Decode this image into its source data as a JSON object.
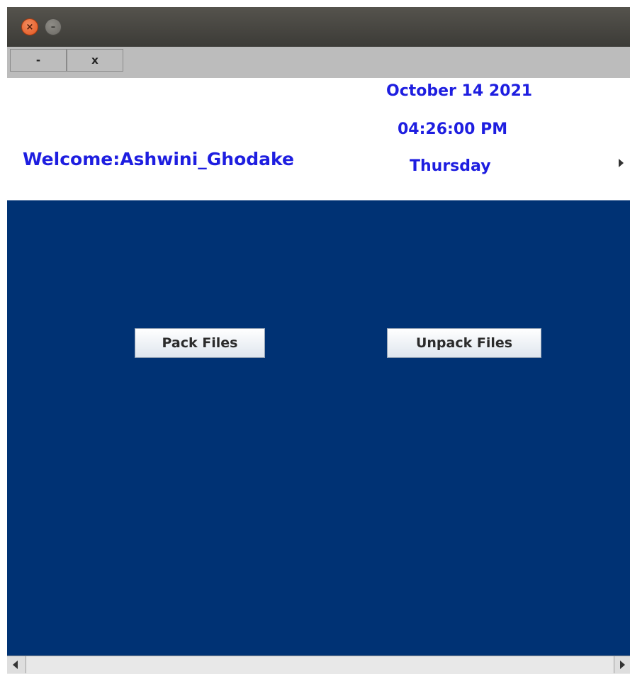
{
  "window": {
    "close_symbol": "×",
    "minimize_symbol": "–"
  },
  "toolbar": {
    "minimize_label": "-",
    "close_label": "x"
  },
  "header": {
    "date": "October 14 2021",
    "time": "04:26:00 PM",
    "day": "Thursday",
    "welcome": "Welcome:Ashwini_Ghodake"
  },
  "main": {
    "pack_label": "Pack Files",
    "unpack_label": "Unpack Files"
  },
  "colors": {
    "panel_background": "#003274",
    "header_text": "#1e1ee0"
  }
}
